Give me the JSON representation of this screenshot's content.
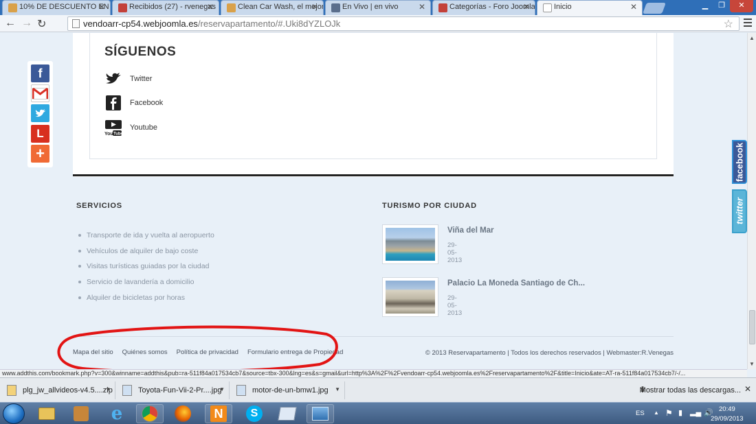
{
  "tabs": [
    {
      "label": "10% DE DESCUENTO EN T",
      "color": "#d9a14a",
      "active": false
    },
    {
      "label": "Recibidos (27) - rvenegas",
      "color": "#c3413a",
      "active": false
    },
    {
      "label": "Clean Car Wash, el mejor",
      "color": "#d9a14a",
      "active": false
    },
    {
      "label": "En Vivo | en vivo",
      "color": "#5a6e8c",
      "active": false
    },
    {
      "label": "Categorías - Foro Joomla!",
      "color": "#c3413a",
      "active": false
    },
    {
      "label": "Inicio",
      "color": "#9aa7b7",
      "active": true
    }
  ],
  "address": {
    "host": "vendoarr-cp54.webjoomla.es",
    "path": "/reservapartamento/#.Uki8dYZLOJk"
  },
  "follow": {
    "title": "SÍGUENOS",
    "items": [
      {
        "label": "Twitter",
        "icon": "twitter-bird-icon"
      },
      {
        "label": "Facebook",
        "icon": "facebook-icon"
      },
      {
        "label": "Youtube",
        "icon": "youtube-icon"
      }
    ]
  },
  "share": [
    {
      "icon": "facebook-share-icon",
      "color": "#3b5998",
      "glyph": "f"
    },
    {
      "icon": "gmail-share-icon",
      "color": "#ffffff",
      "glyph": "M"
    },
    {
      "icon": "twitter-share-icon",
      "color": "#2fa9e0",
      "glyph": "t"
    },
    {
      "icon": "l-share-icon",
      "color": "#d8301f",
      "glyph": "L"
    },
    {
      "icon": "more-share-icon",
      "color": "#f06a35",
      "glyph": "+"
    }
  ],
  "servicios": {
    "title": "SERVICIOS",
    "items": [
      "Transporte de ida y vuelta al aeropuerto",
      "Vehículos de alquiler de bajo coste",
      "Visitas turísticas guiadas por la ciudad",
      "Servicio de lavandería a domicilio",
      "Alquiler de bicicletas por horas"
    ]
  },
  "turismo": {
    "title": "TURISMO POR CIUDAD",
    "items": [
      {
        "name": "Viña del Mar",
        "date": "29-05-2013"
      },
      {
        "name": "Palacio La Moneda Santiago de Ch...",
        "date": "29-05-2013"
      }
    ]
  },
  "footer": {
    "links": [
      "Mapa del sitio",
      "Quiénes somos",
      "Política de privacidad",
      "Formulario entrega de Propiedad"
    ],
    "copyright": "© 2013 Reservapartamento | Todos los derechos reservados | Webmaster:R.Venegas"
  },
  "side_tabs": {
    "facebook": "facebook",
    "twitter": "twitter"
  },
  "status_url": "www.addthis.com/bookmark.php?v=300&winname=addthis&pub=ra-511f84a017534cb7&source=tbx-300&lng=es&s=gmail&url=http%3A%2F%2Fvendoarr-cp54.webjoomla.es%2Freservapartamento%2F&title=Inicio&ate=AT-ra-511f84a017534cb7/-/...",
  "downloads": {
    "items": [
      "plg_jw_allvideos-v4.5....zip",
      "Toyota-Fun-Vii-2-Pr....jpg",
      "motor-de-un-bmw1.jpg"
    ],
    "show_all": "Mostrar todas las descargas..."
  },
  "taskbar": {
    "lang": "ES",
    "time": "20:49",
    "date": "29/09/2013"
  }
}
